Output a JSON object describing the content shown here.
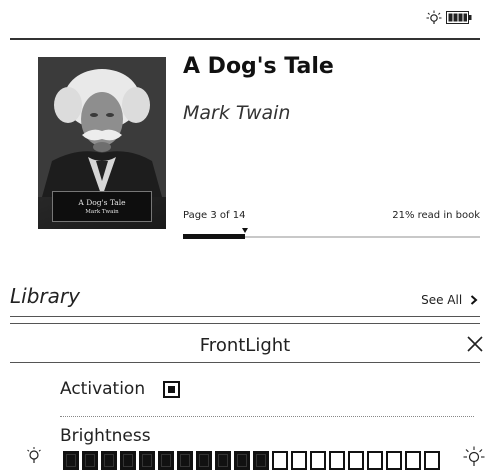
{
  "status_bar": {
    "frontlight_icon": "lightbulb-icon",
    "battery_icon": "battery-icon"
  },
  "book": {
    "title": "A Dog's Tale",
    "author": "Mark Twain",
    "cover_title": "A Dog's Tale",
    "cover_author": "Mark Twain",
    "page_text": "Page 3 of 14",
    "percent_text": "21% read in book",
    "progress_fraction": 0.21
  },
  "library": {
    "heading": "Library",
    "see_all": "See All",
    "see_all_icon": "chevron-right-icon"
  },
  "frontlight": {
    "title": "FrontLight",
    "close_icon": "close-icon",
    "activation_label": "Activation",
    "activation_checked": true,
    "brightness_label": "Brightness",
    "brightness_level": 11,
    "brightness_steps": 20,
    "dim_icon": "lightbulb-off-icon",
    "bright_icon": "lightbulb-on-icon"
  },
  "colors": {
    "ink": "#111111",
    "divider": "#555555",
    "progress_track": "#c8c8c8"
  }
}
